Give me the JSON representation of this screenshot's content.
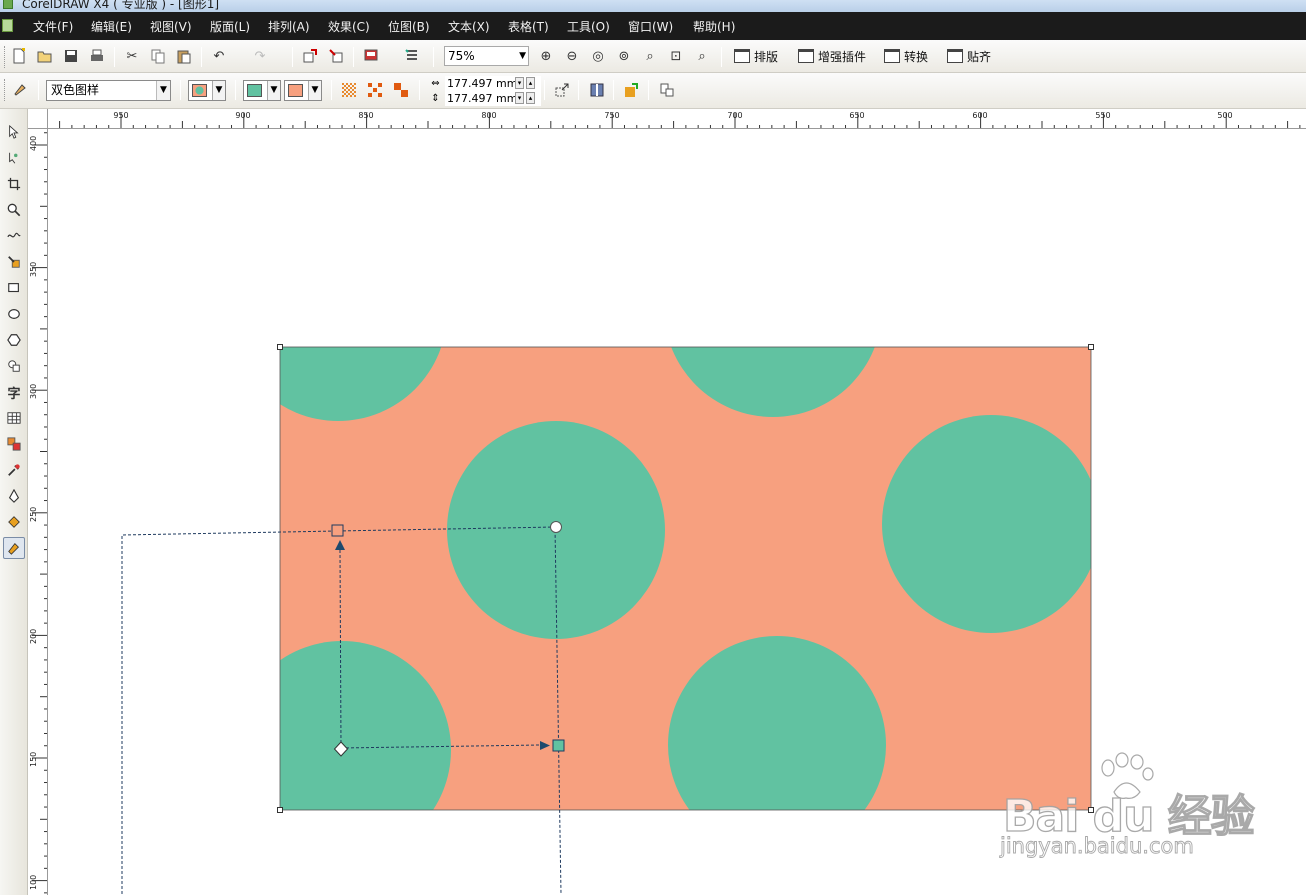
{
  "window": {
    "title": "CorelDRAW X4 ( 专业版 ) - [图形1]"
  },
  "menubar": {
    "items": [
      "文件(F)",
      "编辑(E)",
      "视图(V)",
      "版面(L)",
      "排列(A)",
      "效果(C)",
      "位图(B)",
      "文本(X)",
      "表格(T)",
      "工具(O)",
      "窗口(W)",
      "帮助(H)"
    ]
  },
  "standard_toolbar": {
    "zoom_level": "75%",
    "plugin_buttons": [
      "排版",
      "增强插件",
      "转换",
      "贴齐"
    ]
  },
  "property_bar": {
    "fill_type": "双色图样",
    "front_color": "#61c2a1",
    "back_color": "#f7a07f",
    "tile_width": "177.497 mm",
    "tile_height": "177.497 mm"
  },
  "ruler": {
    "horizontal_labels": [
      "950",
      "900",
      "850",
      "800",
      "750",
      "700",
      "650",
      "600",
      "550",
      "500"
    ],
    "vertical_labels": [
      "400",
      "350",
      "300",
      "250",
      "200",
      "150",
      "100"
    ]
  },
  "artwork": {
    "background_color": "#f7a07f",
    "dot_color": "#61c2a1",
    "outline_color": "#555555"
  },
  "watermark": {
    "brand": "Bai du 经验",
    "url": "jingyan.baidu.com"
  },
  "icons": {
    "toolbox": [
      "pick-tool-icon",
      "shape-tool-icon",
      "crop-tool-icon",
      "zoom-tool-icon",
      "freehand-tool-icon",
      "smart-fill-tool-icon",
      "rectangle-tool-icon",
      "ellipse-tool-icon",
      "polygon-tool-icon",
      "basic-shapes-tool-icon",
      "text-tool-icon",
      "table-tool-icon",
      "interactive-blend-tool-icon",
      "eyedropper-tool-icon",
      "outline-tool-icon",
      "fill-tool-icon",
      "interactive-fill-tool-icon"
    ]
  }
}
